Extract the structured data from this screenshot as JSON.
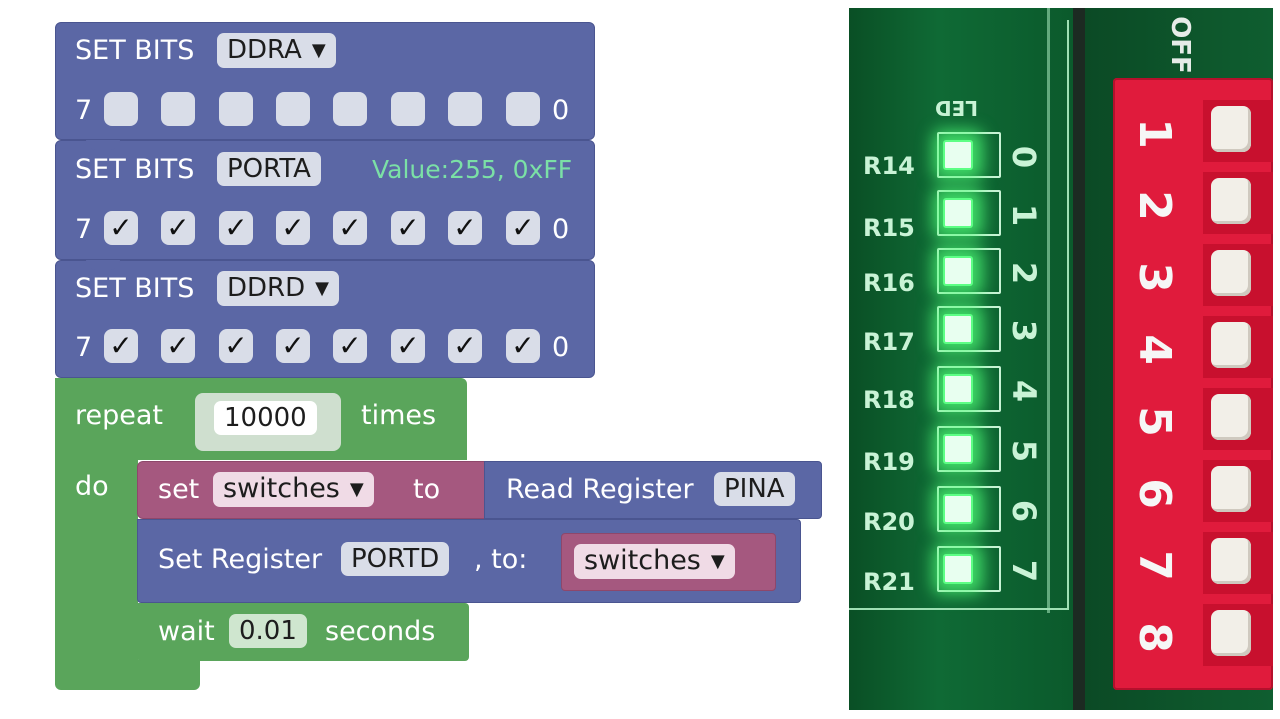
{
  "blocks": {
    "set_bits_1": {
      "label": "SET BITS",
      "register": "DDRA",
      "msb": "7",
      "lsb": "0",
      "bits": [
        "",
        "",
        "",
        "",
        "",
        "",
        "",
        ""
      ]
    },
    "set_bits_2": {
      "label": "SET BITS",
      "register": "PORTA",
      "value_text": "Value:255, 0xFF",
      "msb": "7",
      "lsb": "0",
      "bits": [
        "✓",
        "✓",
        "✓",
        "✓",
        "✓",
        "✓",
        "✓",
        "✓"
      ]
    },
    "set_bits_3": {
      "label": "SET BITS",
      "register": "DDRD",
      "msb": "7",
      "lsb": "0",
      "bits": [
        "✓",
        "✓",
        "✓",
        "✓",
        "✓",
        "✓",
        "✓",
        "✓"
      ]
    },
    "repeat": {
      "label": "repeat",
      "count": "10000",
      "times": "times",
      "do": "do"
    },
    "set_var": {
      "set": "set",
      "variable": "switches",
      "to": "to",
      "read_label": "Read Register",
      "read_register": "PINA"
    },
    "set_register": {
      "label": "Set Register",
      "register": "PORTD",
      "to": ", to:",
      "value_var": "switches"
    },
    "wait": {
      "label": "wait",
      "value": "0.01",
      "unit": "seconds"
    }
  },
  "icons": {
    "dropdown": "▼"
  },
  "photo": {
    "led_header": "LED",
    "resistors": [
      "R14",
      "R15",
      "R16",
      "R17",
      "R18",
      "R19",
      "R20",
      "R21"
    ],
    "led_numbers": [
      "0",
      "1",
      "2",
      "3",
      "4",
      "5",
      "6",
      "7"
    ],
    "dip_label": "OFF",
    "dip_numbers": [
      "1",
      "2",
      "3",
      "4",
      "5",
      "6",
      "7",
      "8"
    ]
  },
  "colors": {
    "block_blue": "#5b67a5",
    "block_green": "#5aa55b",
    "block_pink": "#a5587f",
    "value_text": "#7be0a6",
    "led_green": "#5dff85",
    "dip_red": "#e01b3c",
    "pcb_green": "#0d5d2e"
  }
}
